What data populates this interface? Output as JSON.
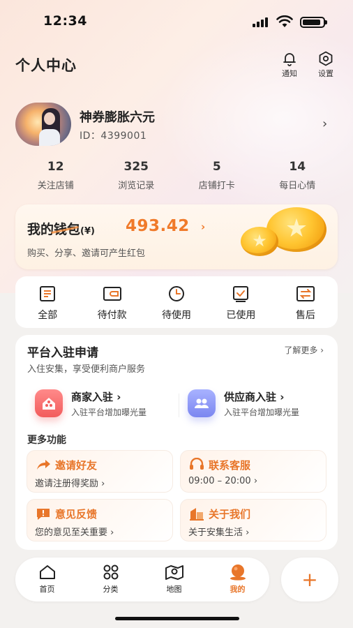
{
  "status_bar": {
    "time": "12:34"
  },
  "header": {
    "title": "个人中心",
    "notify_label": "通知",
    "settings_label": "设置"
  },
  "profile": {
    "name": "神券膨胀六元",
    "id_text": "ID：4399001",
    "chevron": "›"
  },
  "stats": [
    {
      "value": "12",
      "label": "关注店铺"
    },
    {
      "value": "325",
      "label": "浏览记录"
    },
    {
      "value": "5",
      "label": "店铺打卡"
    },
    {
      "value": "14",
      "label": "每日心情"
    }
  ],
  "wallet": {
    "title": "我的钱包",
    "unit": "(¥)",
    "amount": "493.42",
    "chevron": "›",
    "desc": "购买、分享、邀请可产生红包"
  },
  "orders": [
    {
      "label": "全部",
      "icon": "list-icon"
    },
    {
      "label": "待付款",
      "icon": "wallet-icon"
    },
    {
      "label": "待使用",
      "icon": "clock-icon"
    },
    {
      "label": "已使用",
      "icon": "check-icon"
    },
    {
      "label": "售后",
      "icon": "exchange-icon"
    }
  ],
  "platform": {
    "title": "平台入驻申请",
    "learn_more": "了解更多 ›",
    "subtitle": "入住安集，享受便利商户服务",
    "merchant": {
      "title": "商家入驻 ›",
      "desc": "入驻平台增加曝光量"
    },
    "supplier": {
      "title": "供应商入驻 ›",
      "desc": "入驻平台增加曝光量"
    },
    "more_title": "更多功能",
    "features": [
      {
        "title": "邀请好友",
        "desc": "邀请注册得奖励 ›",
        "icon": "share-icon"
      },
      {
        "title": "联系客服",
        "desc": "09:00 – 20:00 ›",
        "icon": "headset-icon"
      },
      {
        "title": "意见反馈",
        "desc": "您的意见至关重要 ›",
        "icon": "feedback-icon"
      },
      {
        "title": "关于我们",
        "desc": "关于安集生活 ›",
        "icon": "building-icon"
      }
    ]
  },
  "tabbar": {
    "items": [
      {
        "label": "首页",
        "icon": "home-icon"
      },
      {
        "label": "分类",
        "icon": "category-icon"
      },
      {
        "label": "地图",
        "icon": "map-icon"
      },
      {
        "label": "我的",
        "icon": "profile-icon",
        "active": true
      }
    ],
    "fab": "+"
  },
  "colors": {
    "accent": "#e8762a",
    "amount": "#f07a2a",
    "page_bg": "#f3f1ef"
  }
}
